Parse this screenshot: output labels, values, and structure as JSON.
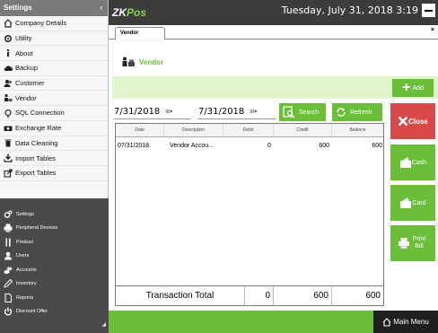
{
  "sidebar": {
    "header": "Settings",
    "collapse_glyph": "‹",
    "items": [
      {
        "label": "Company Details",
        "icon": "home-icon"
      },
      {
        "label": "Utility",
        "icon": "gear-icon"
      },
      {
        "label": "About",
        "icon": "info-icon"
      },
      {
        "label": "Backup",
        "icon": "cloud-icon"
      },
      {
        "label": "Customer",
        "icon": "users-icon"
      },
      {
        "label": "Vendor",
        "icon": "vendor-icon"
      },
      {
        "label": "SQL Connection",
        "icon": "plug-icon"
      },
      {
        "label": "Exchange Rate",
        "icon": "money-icon"
      },
      {
        "label": "Data Cleaning",
        "icon": "trash-icon"
      },
      {
        "label": "Import Tables",
        "icon": "import-icon"
      },
      {
        "label": "Export Tables",
        "icon": "export-icon"
      }
    ],
    "dark_items": [
      {
        "label": "Settings",
        "icon": "gears-icon"
      },
      {
        "label": "Peripheral Devices",
        "icon": "printer-icon"
      },
      {
        "label": "Product",
        "icon": "cutlery-icon"
      },
      {
        "label": "Users",
        "icon": "user-icon"
      },
      {
        "label": "Accounts",
        "icon": "coins-icon"
      },
      {
        "label": "Inventory",
        "icon": "pencil-icon"
      },
      {
        "label": "Reports",
        "icon": "report-icon"
      },
      {
        "label": "Discount Offer",
        "icon": "power-icon"
      }
    ],
    "grip_glyph": "◢"
  },
  "topbar": {
    "brand_main": "ZK",
    "brand_accent": "Pos",
    "datetime": "Tuesday, July 31, 2018 3:19"
  },
  "tabs": {
    "active": "Vendor",
    "close_glyph": "×"
  },
  "page": {
    "title": "Vendor",
    "add_label": "Add",
    "from_date": "7/31/2018",
    "to_date": "7/31/2018",
    "calendar_glyph": "⊞▾",
    "search_label": "Search",
    "refresh_label": "Refresh"
  },
  "grid": {
    "columns": [
      "Date",
      "Description",
      "Debit",
      "Credit",
      "Balance"
    ],
    "rows": [
      {
        "date": "07/31/2018",
        "description": "Vendor Accou...",
        "debit": "0",
        "credit": "600",
        "balance": "600"
      }
    ],
    "footer": {
      "label": "Transaction Total",
      "debit": "0",
      "credit": "600",
      "balance": "600"
    }
  },
  "actions": {
    "close": "Close",
    "cash": "Cash",
    "card": "Card",
    "print_bill": "Print Bill"
  },
  "bottombar": {
    "main_menu": "Main Menu"
  },
  "colors": {
    "accent_green": "#6bbf38",
    "close_red": "#d84848",
    "topbar": "#3c3c3c",
    "sidebar_dark": "#4a4a4a"
  }
}
